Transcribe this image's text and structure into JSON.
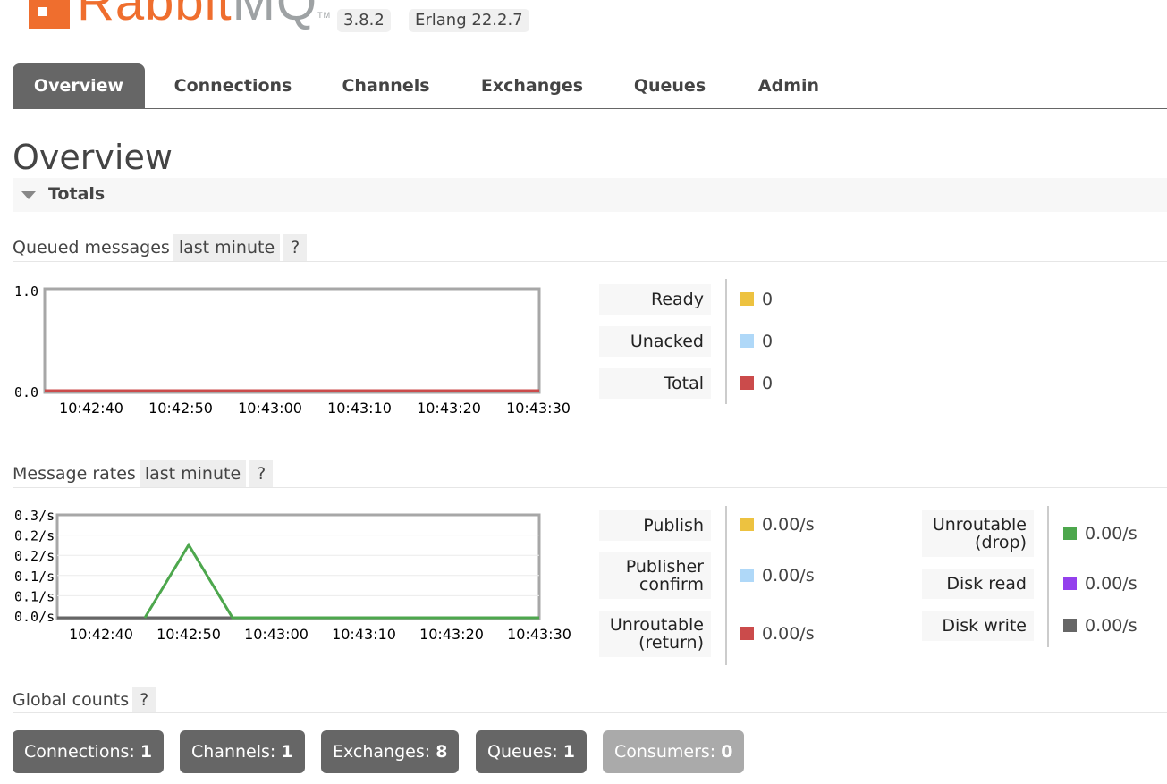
{
  "header": {
    "logo_primary": "Rabbit",
    "logo_secondary": "MQ",
    "logo_tm": "TM",
    "version": "3.8.2",
    "erlang": "Erlang 22.2.7"
  },
  "tabs": [
    {
      "label": "Overview",
      "active": true
    },
    {
      "label": "Connections",
      "active": false
    },
    {
      "label": "Channels",
      "active": false
    },
    {
      "label": "Exchanges",
      "active": false
    },
    {
      "label": "Queues",
      "active": false
    },
    {
      "label": "Admin",
      "active": false
    }
  ],
  "page_title": "Overview",
  "section": {
    "title": "Totals"
  },
  "queued": {
    "heading": "Queued messages",
    "range": "last minute",
    "help": "?",
    "y_ticks": [
      "1.0",
      "0.0"
    ],
    "x_ticks": [
      "10:42:40",
      "10:42:50",
      "10:43:00",
      "10:43:10",
      "10:43:20",
      "10:43:30"
    ],
    "legend": [
      {
        "label": "Ready",
        "value": "0",
        "color": "#edc240"
      },
      {
        "label": "Unacked",
        "value": "0",
        "color": "#afd8f8"
      },
      {
        "label": "Total",
        "value": "0",
        "color": "#cb4b4b"
      }
    ]
  },
  "rates": {
    "heading": "Message rates",
    "range": "last minute",
    "help": "?",
    "y_ticks": [
      "0.3/s",
      "0.2/s",
      "0.2/s",
      "0.1/s",
      "0.1/s",
      "0.0/s"
    ],
    "x_ticks": [
      "10:42:40",
      "10:42:50",
      "10:43:00",
      "10:43:10",
      "10:43:20",
      "10:43:30"
    ],
    "legend_left": [
      {
        "label_lines": [
          "Publish"
        ],
        "value": "0.00/s",
        "color": "#edc240"
      },
      {
        "label_lines": [
          "Publisher",
          "confirm"
        ],
        "value": "0.00/s",
        "color": "#afd8f8"
      },
      {
        "label_lines": [
          "Unroutable",
          "(return)"
        ],
        "value": "0.00/s",
        "color": "#cb4b4b"
      }
    ],
    "legend_right": [
      {
        "label_lines": [
          "Unroutable",
          "(drop)"
        ],
        "value": "0.00/s",
        "color": "#4da74d"
      },
      {
        "label_lines": [
          "Disk read"
        ],
        "value": "0.00/s",
        "color": "#9440ed"
      },
      {
        "label_lines": [
          "Disk write"
        ],
        "value": "0.00/s",
        "color": "#666666"
      }
    ]
  },
  "chart_data": [
    {
      "type": "line",
      "title": "Queued messages",
      "x": [
        "10:42:40",
        "10:42:50",
        "10:43:00",
        "10:43:10",
        "10:43:20",
        "10:43:30"
      ],
      "ylim": [
        0,
        1.0
      ],
      "series": [
        {
          "name": "Ready",
          "color": "#edc240",
          "values": [
            0,
            0,
            0,
            0,
            0,
            0
          ]
        },
        {
          "name": "Unacked",
          "color": "#afd8f8",
          "values": [
            0,
            0,
            0,
            0,
            0,
            0
          ]
        },
        {
          "name": "Total",
          "color": "#cb4b4b",
          "values": [
            0,
            0,
            0,
            0,
            0,
            0
          ]
        }
      ]
    },
    {
      "type": "line",
      "title": "Message rates",
      "x_ticks": [
        "10:42:40",
        "10:42:50",
        "10:43:00",
        "10:43:10",
        "10:43:20",
        "10:43:30"
      ],
      "ylim": [
        0,
        0.25
      ],
      "series": [
        {
          "name": "Unroutable (drop)",
          "color": "#4da74d",
          "points": [
            [
              "10:42:45",
              0
            ],
            [
              "10:42:50",
              0.2
            ],
            [
              "10:42:55",
              0
            ],
            [
              "10:43:30",
              0
            ]
          ]
        },
        {
          "name": "Disk write",
          "color": "#666666",
          "points": [
            [
              "10:42:35",
              0
            ],
            [
              "10:43:30",
              0
            ]
          ]
        }
      ]
    }
  ],
  "global": {
    "heading": "Global counts",
    "help": "?",
    "counts": [
      {
        "label": "Connections:",
        "value": "1"
      },
      {
        "label": "Channels:",
        "value": "1"
      },
      {
        "label": "Exchanges:",
        "value": "8"
      },
      {
        "label": "Queues:",
        "value": "1"
      },
      {
        "label": "Consumers:",
        "value": "0"
      }
    ]
  }
}
